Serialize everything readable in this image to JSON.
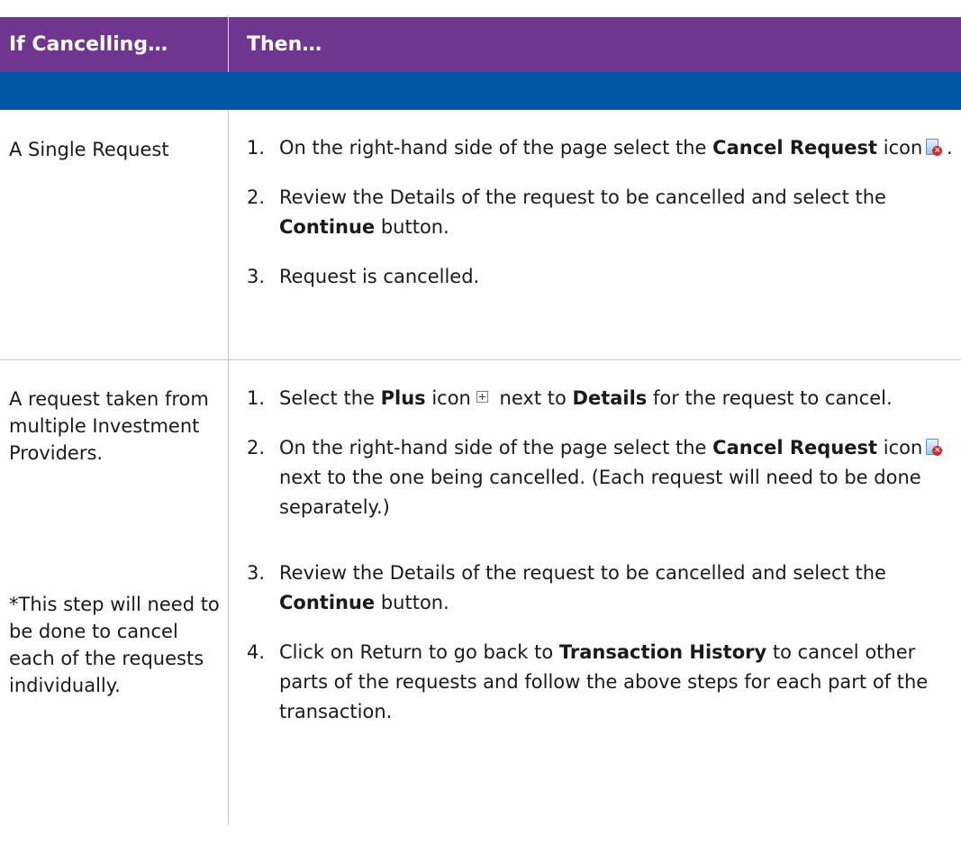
{
  "header": {
    "col1": "If Cancelling…",
    "col2": "Then…"
  },
  "rows": [
    {
      "case": "A Single Request",
      "steps": [
        {
          "num": "1.",
          "pre": "On the right-hand side of the page select the ",
          "bold": "Cancel Request",
          "post1": " icon",
          "post2": " ."
        },
        {
          "num": "2.",
          "pre": "Review the Details of the request to be cancelled and select the ",
          "bold": "Continue",
          "post": " button."
        },
        {
          "num": "3.",
          "text": "Request is cancelled."
        }
      ]
    },
    {
      "case": "A request taken from multiple Investment Providers.",
      "note": "*This step will need to be done to cancel each of the requests individually.",
      "steps": [
        {
          "num": "1.",
          "pre": "Select the ",
          "bold1": "Plus",
          "mid1": " icon",
          "mid2": " next to ",
          "bold2": "Details",
          "post": " for the request to cancel."
        },
        {
          "num": "2.",
          "pre": "On the right-hand side of the page select the ",
          "bold": "Cancel Request",
          "mid": " icon",
          "post": " next to the one being cancelled. (Each request will need to be done separately.)"
        },
        {
          "num": "3.",
          "pre": "Review the Details of the request to be cancelled and select the ",
          "bold": "Continue",
          "post": " button."
        },
        {
          "num": "4.",
          "pre": "Click on Return to go back to ",
          "bold": "Transaction History",
          "post": " to cancel other parts of the requests and follow the above steps for each part of the transaction."
        }
      ]
    }
  ],
  "icons": {
    "cancel_request": "cancel-request-icon",
    "plus": "plus-icon"
  },
  "colors": {
    "header_bg": "#6f368f",
    "band_bg": "#0057a6",
    "cancel_red": "#d8282a"
  }
}
